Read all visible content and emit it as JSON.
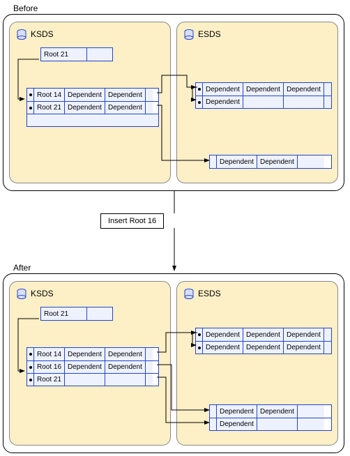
{
  "before": {
    "label": "Before",
    "ksds": {
      "title": "KSDS",
      "header": "Root 21",
      "rows": [
        {
          "root": "Root 14",
          "deps": [
            "Dependent",
            "Dependent"
          ]
        },
        {
          "root": "Root 21",
          "deps": [
            "Dependent",
            "Dependent"
          ]
        }
      ]
    },
    "esds": {
      "title": "ESDS",
      "top_rows": [
        {
          "deps": [
            "Dependent",
            "Dependent",
            "Dependent"
          ]
        },
        {
          "deps": [
            "Dependent",
            "",
            ""
          ]
        }
      ],
      "bottom_rows": [
        {
          "deps": [
            "Dependent",
            "Dependent",
            ""
          ]
        }
      ]
    }
  },
  "insert": {
    "label": "Insert Root 16"
  },
  "after": {
    "label": "After",
    "ksds": {
      "title": "KSDS",
      "header": "Root 21",
      "rows": [
        {
          "root": "Root 14",
          "deps": [
            "Dependent",
            "Dependent"
          ]
        },
        {
          "root": "Root 16",
          "deps": [
            "Dependent",
            "Dependent"
          ]
        },
        {
          "root": "Root 21",
          "deps": [
            "",
            ""
          ]
        }
      ]
    },
    "esds": {
      "title": "ESDS",
      "top_rows": [
        {
          "deps": [
            "Dependent",
            "Dependent",
            "Dependent"
          ]
        },
        {
          "deps": [
            "Dependent",
            "Dependent",
            "Dependent"
          ]
        }
      ],
      "bottom_rows": [
        {
          "deps": [
            "Dependent",
            "Dependent",
            ""
          ]
        },
        {
          "deps": [
            "Dependent",
            "",
            ""
          ]
        }
      ]
    }
  }
}
